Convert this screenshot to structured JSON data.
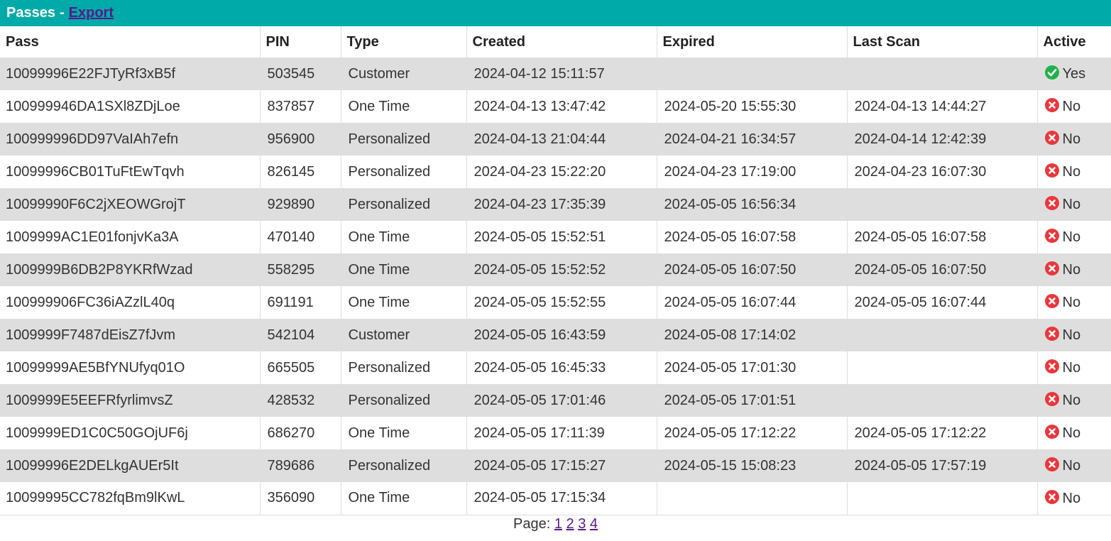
{
  "header": {
    "title": "Passes",
    "separator": "-",
    "export_label": "Export"
  },
  "columns": [
    "Pass",
    "PIN",
    "Type",
    "Created",
    "Expired",
    "Last Scan",
    "Active"
  ],
  "rows": [
    {
      "pass": "10099996E22FJTyRf3xB5f",
      "pin": "503545",
      "type": "Customer",
      "created": "2024-04-12 15:11:57",
      "expired": "",
      "last_scan": "",
      "active": "Yes",
      "active_icon": "check-circle-icon"
    },
    {
      "pass": "100999946DA1SXl8ZDjLoe",
      "pin": "837857",
      "type": "One Time",
      "created": "2024-04-13 13:47:42",
      "expired": "2024-05-20 15:55:30",
      "last_scan": "2024-04-13 14:44:27",
      "active": "No",
      "active_icon": "x-circle-icon"
    },
    {
      "pass": "100999996DD97VaIAh7efn",
      "pin": "956900",
      "type": "Personalized",
      "created": "2024-04-13 21:04:44",
      "expired": "2024-04-21 16:34:57",
      "last_scan": "2024-04-14 12:42:39",
      "active": "No",
      "active_icon": "x-circle-icon"
    },
    {
      "pass": "10099996CB01TuFtEwTqvh",
      "pin": "826145",
      "type": "Personalized",
      "created": "2024-04-23 15:22:20",
      "expired": "2024-04-23 17:19:00",
      "last_scan": "2024-04-23 16:07:30",
      "active": "No",
      "active_icon": "x-circle-icon"
    },
    {
      "pass": "10099990F6C2jXEOWGrojT",
      "pin": "929890",
      "type": "Personalized",
      "created": "2024-04-23 17:35:39",
      "expired": "2024-05-05 16:56:34",
      "last_scan": "",
      "active": "No",
      "active_icon": "x-circle-icon"
    },
    {
      "pass": "1009999AC1E01fonjvKa3A",
      "pin": "470140",
      "type": "One Time",
      "created": "2024-05-05 15:52:51",
      "expired": "2024-05-05 16:07:58",
      "last_scan": "2024-05-05 16:07:58",
      "active": "No",
      "active_icon": "x-circle-icon"
    },
    {
      "pass": "1009999B6DB2P8YKRfWzad",
      "pin": "558295",
      "type": "One Time",
      "created": "2024-05-05 15:52:52",
      "expired": "2024-05-05 16:07:50",
      "last_scan": "2024-05-05 16:07:50",
      "active": "No",
      "active_icon": "x-circle-icon"
    },
    {
      "pass": "100999906FC36iAZzlL40q",
      "pin": "691191",
      "type": "One Time",
      "created": "2024-05-05 15:52:55",
      "expired": "2024-05-05 16:07:44",
      "last_scan": "2024-05-05 16:07:44",
      "active": "No",
      "active_icon": "x-circle-icon"
    },
    {
      "pass": "1009999F7487dEisZ7fJvm",
      "pin": "542104",
      "type": "Customer",
      "created": "2024-05-05 16:43:59",
      "expired": "2024-05-08 17:14:02",
      "last_scan": "",
      "active": "No",
      "active_icon": "x-circle-icon"
    },
    {
      "pass": "10099999AE5BfYNUfyq01O",
      "pin": "665505",
      "type": "Personalized",
      "created": "2024-05-05 16:45:33",
      "expired": "2024-05-05 17:01:30",
      "last_scan": "",
      "active": "No",
      "active_icon": "x-circle-icon"
    },
    {
      "pass": "1009999E5EEFRfyrlimvsZ",
      "pin": "428532",
      "type": "Personalized",
      "created": "2024-05-05 17:01:46",
      "expired": "2024-05-05 17:01:51",
      "last_scan": "",
      "active": "No",
      "active_icon": "x-circle-icon"
    },
    {
      "pass": "1009999ED1C0C50GOjUF6j",
      "pin": "686270",
      "type": "One Time",
      "created": "2024-05-05 17:11:39",
      "expired": "2024-05-05 17:12:22",
      "last_scan": "2024-05-05 17:12:22",
      "active": "No",
      "active_icon": "x-circle-icon"
    },
    {
      "pass": "10099996E2DELkgAUEr5It",
      "pin": "789686",
      "type": "Personalized",
      "created": "2024-05-05 17:15:27",
      "expired": "2024-05-15 15:08:23",
      "last_scan": "2024-05-05 17:57:19",
      "active": "No",
      "active_icon": "x-circle-icon"
    },
    {
      "pass": "10099995CC782fqBm9lKwL",
      "pin": "356090",
      "type": "One Time",
      "created": "2024-05-05 17:15:34",
      "expired": "",
      "last_scan": "",
      "active": "No",
      "active_icon": "x-circle-icon"
    }
  ],
  "pager": {
    "label": "Page:",
    "pages": [
      "1",
      "2",
      "3",
      "4"
    ]
  },
  "colors": {
    "header_bg": "#00aaa8",
    "link": "#551a8b",
    "row_stripe": "#dedede",
    "active_yes": "#22b14c",
    "active_no": "#e8383d"
  }
}
